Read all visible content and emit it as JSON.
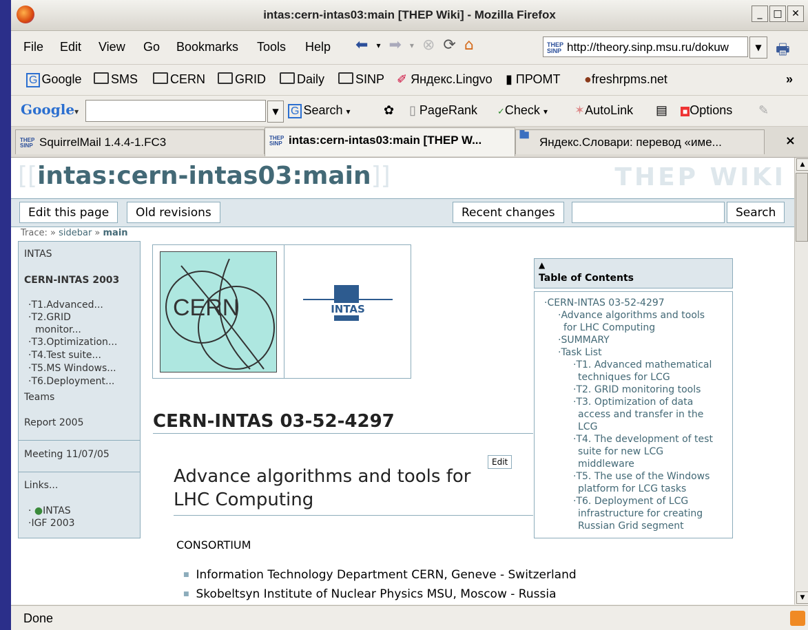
{
  "window": {
    "title": "intas:cern-intas03:main [THEP Wiki] - Mozilla Firefox"
  },
  "menu": [
    "File",
    "Edit",
    "View",
    "Go",
    "Bookmarks",
    "Tools",
    "Help"
  ],
  "url": "http://theory.sinp.msu.ru/dokuw",
  "bookmarks": [
    "Google",
    "SMS",
    "CERN",
    "GRID",
    "Daily",
    "SINP",
    "Яндекс.Lingvo",
    "ПРОМТ",
    "freshrpms.net"
  ],
  "googlebar": {
    "logo": "Google",
    "search": "Search",
    "pagerank": "PageRank",
    "check": "Check",
    "autolink": "AutoLink",
    "options": "Options"
  },
  "tabs": [
    {
      "label": "SquirrelMail 1.4.4-1.FC3"
    },
    {
      "label": "intas:cern-intas03:main [THEP W..."
    },
    {
      "label": "Яндекс.Словари: перевод «име..."
    }
  ],
  "page": {
    "title": "intas:cern-intas03:main",
    "wiki_name": "THEP WIKI",
    "actions": {
      "edit": "Edit this page",
      "old": "Old revisions",
      "recent": "Recent changes",
      "search": "Search"
    },
    "trace": {
      "label": "Trace:",
      "items": [
        "sidebar",
        "main"
      ]
    },
    "sidebar": {
      "intas": "INTAS",
      "cern": "CERN-INTAS 2003",
      "tasks": [
        "T1.Advanced...",
        "T2.GRID",
        "monitor...",
        "T3.Optimization...",
        "T4.Test suite...",
        "T5.MS Windows...",
        "T6.Deployment..."
      ],
      "teams": "Teams",
      "report": "Report 2005",
      "meeting": "Meeting 11/07/05",
      "links": "Links...",
      "link_items": [
        "INTAS",
        "IGF 2003"
      ]
    },
    "logos": {
      "cern": "CERN",
      "intas": "INTAS"
    },
    "heading": "CERN-INTAS 03-52-4297",
    "edit": "Edit",
    "subheading": "Advance algorithms and tools for LHC Computing",
    "consortium": "CONSORTIUM",
    "members": [
      "Information Technology Department CERN, Geneve - Switzerland",
      "Skobeltsyn Institute of Nuclear Physics MSU, Moscow - Russia"
    ],
    "toc": {
      "title": "Table of Contents",
      "items": [
        "CERN-INTAS 03-52-4297",
        "Advance algorithms and tools",
        "for LHC Computing",
        "SUMMARY",
        "Task List",
        "T1. Advanced mathematical",
        "techniques for LCG",
        "T2. GRID monitoring tools",
        "T3. Optimization of data",
        "access and transfer in the",
        "LCG",
        "T4. The development of test",
        "suite for new LCG",
        "middleware",
        "T5. The use of the Windows",
        "platform for LCG tasks",
        "T6. Deployment of LCG",
        "infrastructure for creating",
        "Russian Grid segment"
      ]
    }
  },
  "status": "Done"
}
